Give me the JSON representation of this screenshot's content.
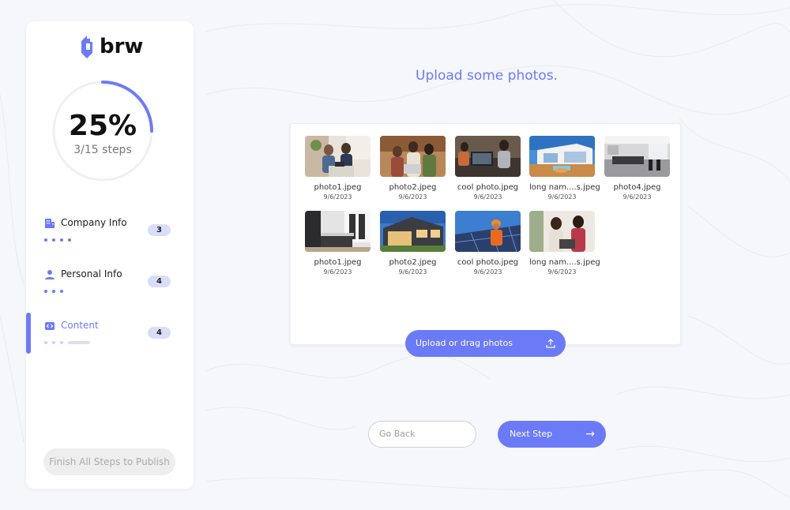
{
  "brand": {
    "name": "brw",
    "accent": "#6b7bf7"
  },
  "progress": {
    "percent_label": "25%",
    "steps_label": "3/15 steps",
    "value": 0.25
  },
  "steps": [
    {
      "label": "Company Info",
      "count": "3",
      "icon": "building-icon"
    },
    {
      "label": "Personal Info",
      "count": "4",
      "icon": "user-icon"
    },
    {
      "label": "Content",
      "count": "4",
      "icon": "code-icon",
      "active": true
    }
  ],
  "finish_label": "Finish All Steps to Publish",
  "main": {
    "title": "Upload some photos."
  },
  "photos": [
    {
      "name": "photo1.jpeg",
      "date": "9/6/2023",
      "scene": "office-meeting"
    },
    {
      "name": "photo2.jpeg",
      "date": "9/6/2023",
      "scene": "team-laptop"
    },
    {
      "name": "cool photo.jpeg",
      "date": "9/6/2023",
      "scene": "workspace"
    },
    {
      "name": "long nam....s.jpeg",
      "date": "9/6/2023",
      "scene": "modern-house"
    },
    {
      "name": "photo4.jpeg",
      "date": "9/6/2023",
      "scene": "kitchen"
    },
    {
      "name": "photo1.jpeg",
      "date": "9/6/2023",
      "scene": "kitchen-dark"
    },
    {
      "name": "photo2.jpeg",
      "date": "9/6/2023",
      "scene": "house-night"
    },
    {
      "name": "cool photo.jpeg",
      "date": "9/6/2023",
      "scene": "solar-worker"
    },
    {
      "name": "long nam....s.jpeg",
      "date": "9/6/2023",
      "scene": "women-laptop"
    }
  ],
  "upload_label": "Upload or drag photos",
  "back_label": "Go Back",
  "next_label": "Next Step"
}
